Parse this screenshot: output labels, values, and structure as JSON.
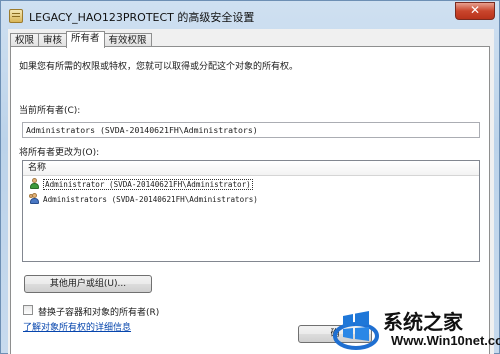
{
  "window": {
    "title": "LEGACY_HAO123PROTECT 的高级安全设置",
    "close_glyph": "✕"
  },
  "tabs": [
    {
      "label": "权限"
    },
    {
      "label": "审核"
    },
    {
      "label": "所有者",
      "active": true
    },
    {
      "label": "有效权限"
    }
  ],
  "owner_panel": {
    "description": "如果您有所需的权限或特权，您就可以取得或分配这个对象的所有权。",
    "current_owner_label": "当前所有者(C):",
    "current_owner_value": "Administrators (SVDA-20140621FH\\Administrators)",
    "change_owner_label": "将所有者更改为(O):",
    "list_header": "名称",
    "candidates": [
      {
        "icon": "user-icon",
        "name": "Administrator (SVDA-20140621FH\\Administrator)",
        "selected": true
      },
      {
        "icon": "group-icon",
        "name": "Administrators (SVDA-20140621FH\\Administrators)",
        "selected": false
      }
    ],
    "other_users_button": "其他用户或组(U)...",
    "replace_checkbox_label": "替换子容器和对象的所有者(R)",
    "replace_checkbox_checked": false,
    "help_link": "了解对象所有权的详细信息"
  },
  "footer": {
    "ok_button": "确"
  },
  "watermark": {
    "text_cn": "系统之家",
    "text_url": "Www.Win10net.com"
  }
}
